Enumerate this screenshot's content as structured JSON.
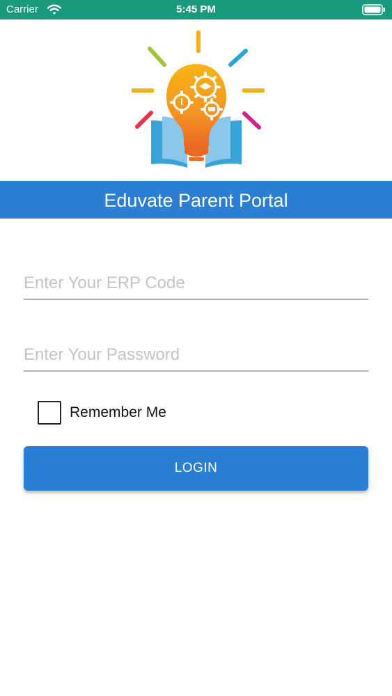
{
  "status_bar": {
    "carrier": "Carrier",
    "time": "5:45 PM",
    "icons": [
      "wifi-icon",
      "battery-icon"
    ],
    "background_color": "#1a9a7c"
  },
  "header": {
    "logo": "eduvate-lightbulb-logo",
    "title": "Eduvate Parent Portal",
    "banner_color": "#2a7fd4"
  },
  "login_form": {
    "erp_code": {
      "placeholder": "Enter Your ERP Code",
      "value": ""
    },
    "password": {
      "placeholder": "Enter Your Password",
      "value": ""
    },
    "remember_me": {
      "label": "Remember Me",
      "checked": false
    },
    "login_button": {
      "label": "LOGIN",
      "color": "#2a7fd4"
    }
  }
}
